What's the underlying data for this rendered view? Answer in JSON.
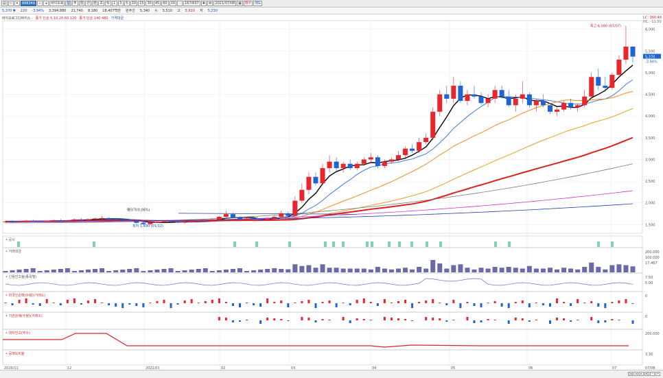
{
  "toolbar": {
    "symbol": "008340",
    "name": "바이오로",
    "buttons": [
      "주",
      "월",
      "년",
      "분",
      "초",
      "틱"
    ],
    "intervals": [
      "1",
      "3",
      "5",
      "10",
      "15",
      "30",
      "45",
      "60",
      "10",
      "-"
    ],
    "count": "167/837",
    "date": "2021/07/08",
    "right_buttons": [
      "매수",
      "매도"
    ]
  },
  "info": {
    "price": "5,370 ▼",
    "change": "220",
    "change_pct": "-3.94%",
    "volume": "3,394,880",
    "v2": "21,740",
    "v3": "8,180",
    "v4": "18,407백만",
    "prev_label": "원주선",
    "prev": "5,340",
    "open_label": "시",
    "open": "5,510",
    "high_label": "고",
    "high": "5,610",
    "low_label": "저",
    "low": "5,230"
  },
  "legend": {
    "prefix": "바이오로그디바이스 ·",
    "ma_short": "종가 단순 5 10 20 60 120",
    "ma_long": "종가 단순 240 480",
    "bollinger": "가격대금"
  },
  "annotations": {
    "high_label": "최고 6,080 (07/07)",
    "low_label": "최저 1,490 (01/12)",
    "mid_label": "평단가(0.06%)",
    "price_tag": "5,370",
    "pct_tag": "-3.94%",
    "top_right_a": "LC: 360.48",
    "top_right_b": "HC: -11.50"
  },
  "price_axis": [
    "6,000",
    "5,500",
    "5,000",
    "4,500",
    "4,000",
    "3,500",
    "3,000",
    "2,500",
    "2,000",
    "1,500"
  ],
  "x_axis": [
    "2020/11",
    "12",
    "2021/01",
    "02",
    "03",
    "04",
    "05",
    "06",
    "07",
    "07/08"
  ],
  "panels": [
    {
      "label": "공시",
      "axis": []
    },
    {
      "label": "거래대금",
      "axis": [
        "200,000",
        "100,000",
        "17,467"
      ]
    },
    {
      "label": "신용잔고율(종목별)",
      "axis": [
        "7.50",
        "5.00"
      ]
    },
    {
      "label": "외국인순매(수량)(거래소)",
      "axis": [
        "0"
      ]
    },
    {
      "label": "기관순매(수량)(거래소)",
      "axis": [
        "0"
      ]
    },
    {
      "label": "대차잔고(주수)",
      "axis": [
        "200,000"
      ]
    },
    {
      "label": "공매도비율",
      "axis": [
        "3.30"
      ]
    }
  ],
  "colors": {
    "up": "#e8262d",
    "down": "#1f64d4",
    "ma5": "#000000",
    "ma10": "#3a7be0",
    "ma20": "#f08a20",
    "ma60": "#e8a020",
    "ma120": "#e01e1e",
    "ma240": "#7a7a7a",
    "ma480": "#cc33cc"
  },
  "chart_data": {
    "type": "candlestick",
    "ylim": [
      1300,
      6200
    ],
    "candles": [
      [
        1560,
        1590,
        1530,
        1570
      ],
      [
        1570,
        1600,
        1550,
        1560
      ],
      [
        1560,
        1580,
        1540,
        1575
      ],
      [
        1575,
        1610,
        1560,
        1590
      ],
      [
        1590,
        1620,
        1570,
        1580
      ],
      [
        1580,
        1600,
        1560,
        1570
      ],
      [
        1570,
        1590,
        1550,
        1585
      ],
      [
        1585,
        1620,
        1570,
        1600
      ],
      [
        1600,
        1630,
        1580,
        1590
      ],
      [
        1590,
        1610,
        1570,
        1600
      ],
      [
        1600,
        1640,
        1590,
        1620
      ],
      [
        1620,
        1650,
        1600,
        1610
      ],
      [
        1610,
        1630,
        1590,
        1625
      ],
      [
        1625,
        1660,
        1610,
        1640
      ],
      [
        1640,
        1700,
        1620,
        1650
      ],
      [
        1650,
        1670,
        1620,
        1630
      ],
      [
        1630,
        1650,
        1600,
        1620
      ],
      [
        1620,
        1640,
        1580,
        1600
      ],
      [
        1600,
        1620,
        1560,
        1580
      ],
      [
        1580,
        1600,
        1520,
        1540
      ],
      [
        1540,
        1560,
        1490,
        1510
      ],
      [
        1510,
        1560,
        1490,
        1550
      ],
      [
        1550,
        1580,
        1530,
        1560
      ],
      [
        1560,
        1590,
        1540,
        1570
      ],
      [
        1570,
        1590,
        1540,
        1560
      ],
      [
        1560,
        1580,
        1530,
        1550
      ],
      [
        1550,
        1570,
        1520,
        1560
      ],
      [
        1560,
        1600,
        1540,
        1580
      ],
      [
        1580,
        1610,
        1560,
        1590
      ],
      [
        1590,
        1620,
        1570,
        1600
      ],
      [
        1600,
        1640,
        1580,
        1620
      ],
      [
        1620,
        1700,
        1600,
        1680
      ],
      [
        1680,
        1820,
        1650,
        1740
      ],
      [
        1740,
        1780,
        1640,
        1660
      ],
      [
        1660,
        1690,
        1600,
        1620
      ],
      [
        1620,
        1660,
        1590,
        1640
      ],
      [
        1640,
        1680,
        1610,
        1620
      ],
      [
        1620,
        1640,
        1580,
        1600
      ],
      [
        1600,
        1650,
        1590,
        1640
      ],
      [
        1640,
        1700,
        1620,
        1680
      ],
      [
        1680,
        1820,
        1660,
        1760
      ],
      [
        1760,
        1800,
        1680,
        1700
      ],
      [
        1700,
        2150,
        1690,
        2050
      ],
      [
        2050,
        2450,
        2000,
        2300
      ],
      [
        2300,
        2700,
        2200,
        2600
      ],
      [
        2600,
        2700,
        2400,
        2450
      ],
      [
        2450,
        2900,
        2400,
        2800
      ],
      [
        2800,
        3100,
        2700,
        2950
      ],
      [
        2950,
        3050,
        2700,
        2800
      ],
      [
        2800,
        2950,
        2700,
        2900
      ],
      [
        2900,
        3000,
        2750,
        2800
      ],
      [
        2800,
        2950,
        2750,
        2900
      ],
      [
        2900,
        3050,
        2850,
        3000
      ],
      [
        3000,
        3150,
        2900,
        3050
      ],
      [
        3050,
        3100,
        2800,
        2850
      ],
      [
        2850,
        3000,
        2800,
        2950
      ],
      [
        2950,
        3050,
        2900,
        3000
      ],
      [
        3000,
        3200,
        2950,
        3100
      ],
      [
        3100,
        3300,
        3050,
        3250
      ],
      [
        3250,
        3350,
        3150,
        3200
      ],
      [
        3200,
        3500,
        3150,
        3400
      ],
      [
        3400,
        3600,
        3350,
        3500
      ],
      [
        3500,
        4200,
        3450,
        4100
      ],
      [
        4100,
        4600,
        4000,
        4500
      ],
      [
        4500,
        4700,
        4300,
        4400
      ],
      [
        4400,
        4900,
        4300,
        4700
      ],
      [
        4700,
        4800,
        4300,
        4350
      ],
      [
        4350,
        4600,
        4250,
        4500
      ],
      [
        4500,
        4700,
        4400,
        4450
      ],
      [
        4450,
        4550,
        4250,
        4300
      ],
      [
        4300,
        4500,
        4200,
        4400
      ],
      [
        4400,
        4700,
        4300,
        4600
      ],
      [
        4600,
        4700,
        4400,
        4450
      ],
      [
        4450,
        4600,
        4200,
        4250
      ],
      [
        4250,
        4500,
        4100,
        4400
      ],
      [
        4400,
        4800,
        4300,
        4500
      ],
      [
        4500,
        4550,
        4200,
        4250
      ],
      [
        4250,
        4400,
        4100,
        4350
      ],
      [
        4350,
        4500,
        4200,
        4250
      ],
      [
        4250,
        4300,
        4050,
        4100
      ],
      [
        4100,
        4200,
        4000,
        4150
      ],
      [
        4150,
        4350,
        4100,
        4300
      ],
      [
        4300,
        4400,
        4150,
        4200
      ],
      [
        4200,
        4300,
        4100,
        4250
      ],
      [
        4250,
        4600,
        4200,
        4450
      ],
      [
        4450,
        5000,
        4400,
        4900
      ],
      [
        4900,
        5100,
        4600,
        4700
      ],
      [
        4700,
        4900,
        4550,
        4650
      ],
      [
        4650,
        5000,
        4600,
        4950
      ],
      [
        4950,
        5400,
        4900,
        5300
      ],
      [
        5300,
        6080,
        5200,
        5600
      ],
      [
        5600,
        5610,
        5230,
        5370
      ]
    ]
  }
}
